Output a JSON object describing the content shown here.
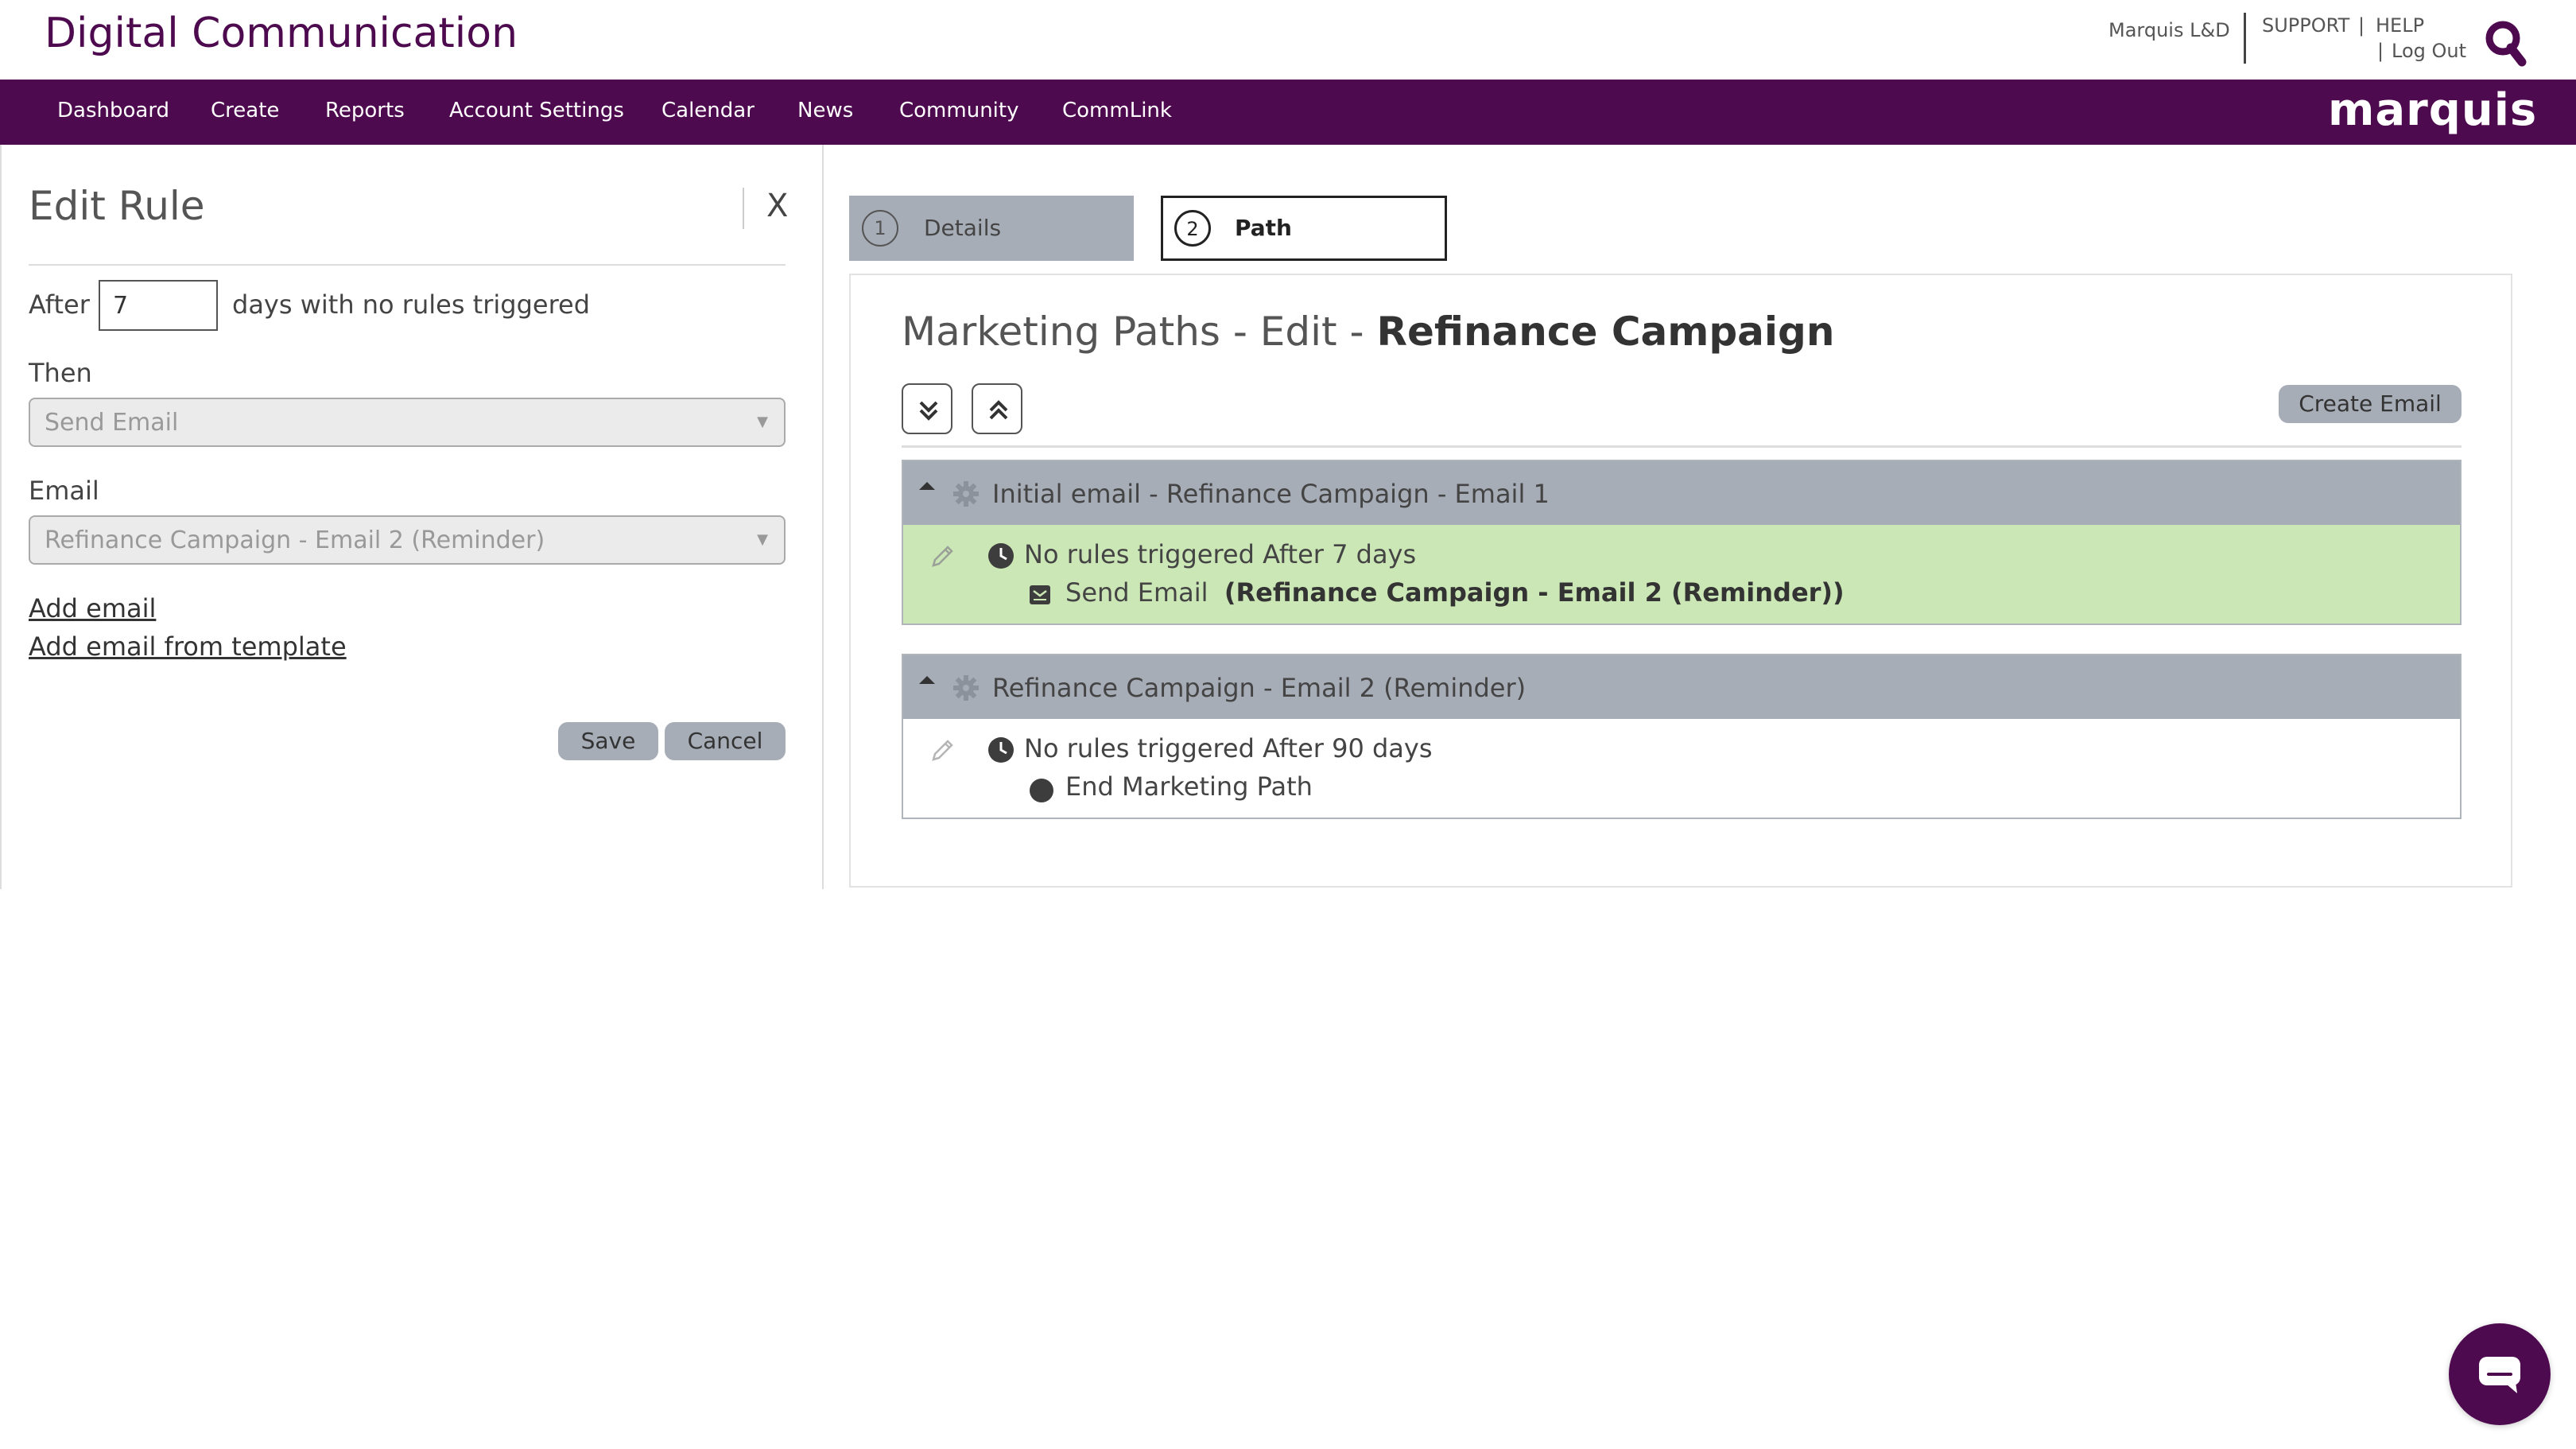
{
  "header": {
    "app_title": "Digital Communication",
    "user_name": "Marquis L&D",
    "support_label": "SUPPORT",
    "separator": "|",
    "help_label": "HELP",
    "logout_label": "Log Out",
    "search_icon": "search-icon",
    "brand_color": "#4e0a4f"
  },
  "nav": {
    "items": [
      "Dashboard",
      "Create",
      "Reports",
      "Account Settings",
      "Calendar",
      "News",
      "Community",
      "CommLink"
    ],
    "brand_logo": "marquis"
  },
  "edit_rule": {
    "title": "Edit Rule",
    "close_label": "X",
    "after_label": "After",
    "days_value": "7",
    "days_suffix": "days with no rules triggered",
    "then_label": "Then",
    "then_value": "Send Email",
    "email_label": "Email",
    "email_value": "Refinance Campaign - Email 2 (Reminder)",
    "add_email_link": "Add email",
    "add_template_link": "Add email from template",
    "save_label": "Save",
    "cancel_label": "Cancel"
  },
  "steps": [
    {
      "number": "1",
      "label": "Details"
    },
    {
      "number": "2",
      "label": "Path"
    }
  ],
  "path_editor": {
    "heading_prefix": "Marketing Paths - Edit - ",
    "heading_name": "Refinance Campaign",
    "expand_all_icon": "double-chevron-down-icon",
    "collapse_all_icon": "double-chevron-up-icon",
    "create_email_label": "Create Email",
    "emails": [
      {
        "title": "Initial email - Refinance Campaign - Email 1",
        "rule_text": "No rules triggered After 7 days",
        "action_label": "Send Email",
        "action_detail": "(Refinance Campaign - Email 2 (Reminder))",
        "action_icon": "envelope-icon",
        "highlight_color": "#cbe7b6"
      },
      {
        "title": "Refinance Campaign - Email 2 (Reminder)",
        "rule_text": "No rules triggered After 90 days",
        "action_label": "End Marketing Path",
        "action_detail": "",
        "action_icon": "end-circle-icon"
      }
    ]
  },
  "chat": {
    "icon": "chat-bubble-icon"
  }
}
